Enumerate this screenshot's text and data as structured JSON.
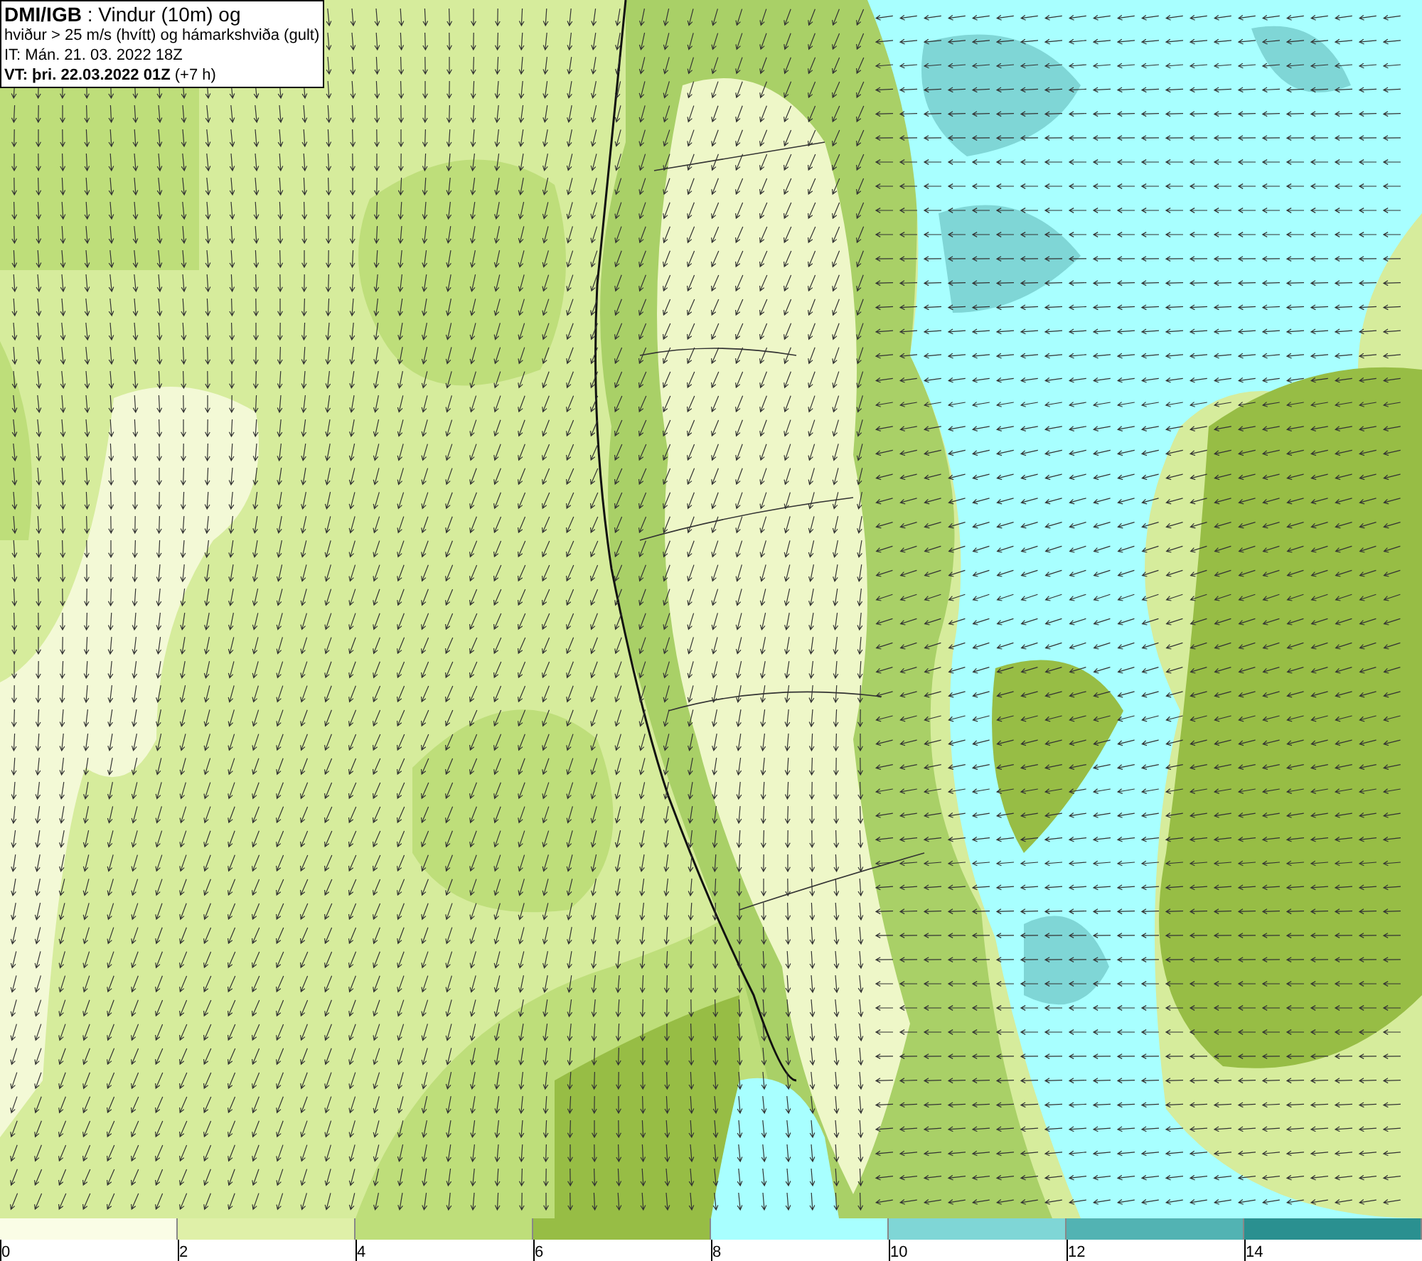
{
  "title_box": {
    "lines": [
      "**DMI/IGB** : Vindur (10m) og",
      "hviður > 25 m/s (hvítt) og hámarkshviða (gult)",
      "IT: Mán. 21. 03. 2022 18Z",
      "**VT: þri. 22.03.2022 01Z** (+7 h)"
    ]
  },
  "legend": {
    "bins": [
      {
        "label": "0",
        "color": "#fafde6"
      },
      {
        "label": "2",
        "color": "#dff0a8"
      },
      {
        "label": "4",
        "color": "#bede7a"
      },
      {
        "label": "6",
        "color": "#97bd45"
      },
      {
        "label": "8",
        "color": "#a8ffff"
      },
      {
        "label": "10",
        "color": "#7fd6d6"
      },
      {
        "label": "12",
        "color": "#52b3b3"
      },
      {
        "label": "14",
        "color": "#2a9090"
      }
    ]
  }
}
